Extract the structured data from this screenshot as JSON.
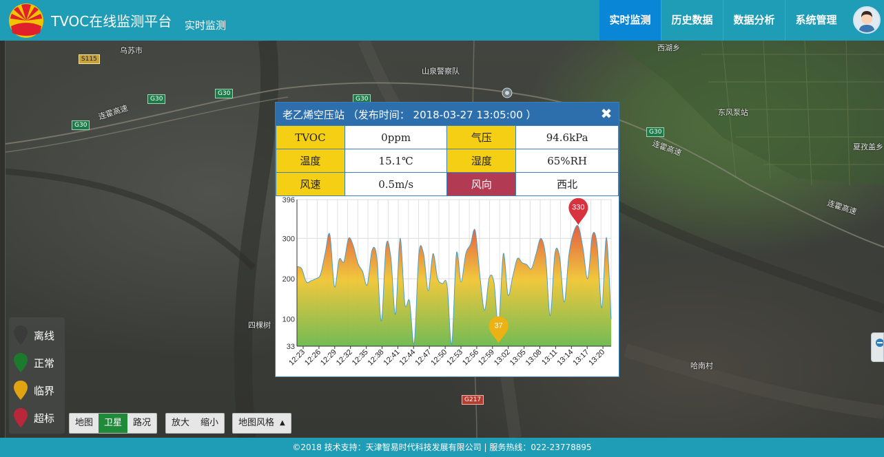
{
  "header": {
    "title": "TVOC在线监测平台",
    "subtitle": "实时监测",
    "nav": [
      {
        "label": "实时监测",
        "active": true
      },
      {
        "label": "历史数据",
        "active": false
      },
      {
        "label": "数据分析",
        "active": false
      },
      {
        "label": "系统管理",
        "active": false
      }
    ]
  },
  "map": {
    "labels": {
      "city_wusu": "乌苏市",
      "road_g30_a": "G30",
      "road_g30_b": "G30",
      "road_g30_c": "G30",
      "road_g30_d": "G30",
      "road_g30_e": "G30",
      "road_s115": "S115",
      "road_g217": "G217",
      "expressway_a": "连霍高速",
      "expressway_b": "连霍高速",
      "expressway_c": "连霍高速",
      "place_a": "山泉警察队",
      "place_b": "东风泵站",
      "place_c": "西湖乡",
      "place_d": "四棵树",
      "place_e": "哈南村",
      "place_f": "夏孜盖乡"
    },
    "controls": {
      "map_type": [
        {
          "label": "地图",
          "active": false
        },
        {
          "label": "卫星",
          "active": true
        },
        {
          "label": "路况",
          "active": false
        }
      ],
      "zoom_in": "放大",
      "zoom_out": "缩小",
      "style": "地图风格",
      "style_caret": "▲"
    }
  },
  "legend": [
    {
      "label": "离线",
      "color": "#3b3b3b"
    },
    {
      "label": "正常",
      "color": "#1b7a2c"
    },
    {
      "label": "临界",
      "color": "#e0a312"
    },
    {
      "label": "超标",
      "color": "#b8283a"
    }
  ],
  "popup": {
    "title": "老乙烯空压站 （发布时间： 2018-03-27 13:05:00 ）",
    "close_icon": "✖",
    "rows": [
      [
        {
          "k": "TVOC",
          "v": "0ppm"
        },
        {
          "k": "气压",
          "v": "94.6kPa"
        }
      ],
      [
        {
          "k": "温度",
          "v": "15.1℃"
        },
        {
          "k": "湿度",
          "v": "65%RH"
        }
      ],
      [
        {
          "k": "风速",
          "v": "0.5m/s"
        },
        {
          "k": "风向",
          "v": "西北"
        }
      ]
    ]
  },
  "chart_data": {
    "type": "area",
    "title": "",
    "xlabel": "",
    "ylabel": "",
    "ylim": [
      33,
      396
    ],
    "yticks": [
      33,
      100,
      200,
      300,
      396
    ],
    "xtick_labels": [
      "12:23",
      "12:26",
      "12:29",
      "12:32",
      "12:35",
      "12:38",
      "12:41",
      "12:44",
      "12:47",
      "12:50",
      "12:53",
      "12:56",
      "12:59",
      "13:02",
      "13:05",
      "13:08",
      "13:11",
      "13:14",
      "13:17",
      "13:20"
    ],
    "grid": true,
    "gradient_colors": [
      "#e2553a",
      "#f0c533",
      "#6bb84c"
    ],
    "line_color": "#4aa0c7",
    "series": [
      {
        "values": [
          230,
          225,
          192,
          195,
          200,
          210,
          262,
          310,
          180,
          248,
          242,
          300,
          282,
          238,
          218,
          185,
          270,
          255,
          95,
          282,
          255,
          112,
          300,
          138,
          145,
          40,
          262,
          262,
          170,
          262,
          200,
          188,
          185,
          38,
          262,
          192,
          262,
          285,
          320,
          208,
          122,
          202,
          192,
          82,
          262,
          160,
          205,
          250,
          240,
          235,
          225,
          262,
          300,
          258,
          108,
          262,
          255,
          142,
          260,
          315,
          330,
          275,
          200,
          308,
          285,
          128,
          302,
          100
        ],
        "max": {
          "value": 330,
          "label": "330"
        },
        "min": {
          "value": 37,
          "label": "37"
        }
      }
    ]
  },
  "footer": {
    "text": "©2018 技术支持：天津智易时代科技发展有限公司 | 服务热线：022-23778895"
  }
}
